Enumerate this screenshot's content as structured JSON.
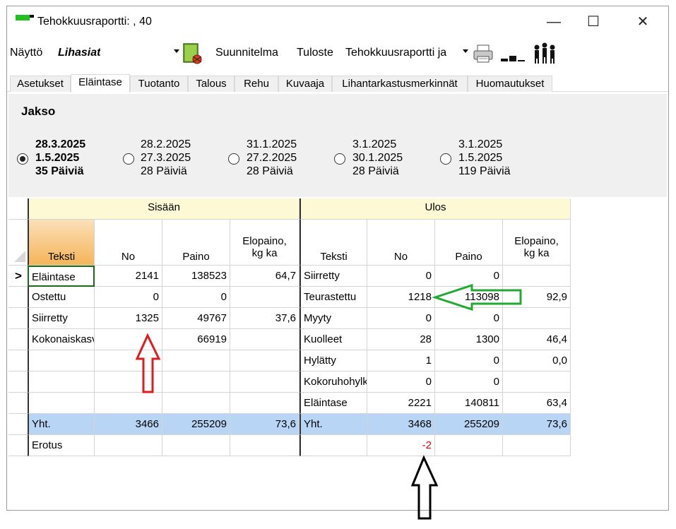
{
  "window": {
    "title": "Tehokkuusraportti: , 40",
    "minimize_label": "—",
    "maximize_label": "☐",
    "close_label": "✕"
  },
  "toolbar": {
    "nayttö_label": "Näyttö",
    "view_value": "Lihasiat",
    "suunnitelma_label": "Suunnitelma",
    "tuloste_label": "Tuloste",
    "report_value": "Tehokkuusraportti ja",
    "icons": [
      "book-bug-icon",
      "printer-icon",
      "bars-icon",
      "people-icon"
    ]
  },
  "tabs": [
    "Asetukset",
    "Eläintase",
    "Tuotanto",
    "Talous",
    "Rehu",
    "Kuvaaja",
    "Lihantarkastusmerkinnät",
    "Huomautukset"
  ],
  "active_tab": "Eläintase",
  "jakso": {
    "title": "Jakso",
    "periods": [
      {
        "start": "28.3.2025",
        "end": "1.5.2025",
        "days": "35 Päiviä",
        "selected": true
      },
      {
        "start": "28.2.2025",
        "end": "27.3.2025",
        "days": "28 Päiviä",
        "selected": false
      },
      {
        "start": "31.1.2025",
        "end": "27.2.2025",
        "days": "28 Päiviä",
        "selected": false
      },
      {
        "start": "3.1.2025",
        "end": "30.1.2025",
        "days": "28 Päiviä",
        "selected": false
      },
      {
        "start": "3.1.2025",
        "end": "1.5.2025",
        "days": "119 Päiviä",
        "selected": false
      }
    ]
  },
  "table": {
    "group_in": "Sisään",
    "group_out": "Ulos",
    "headers_in": [
      "Teksti",
      "No",
      "Paino",
      "Elopaino,\nkg ka"
    ],
    "headers_out": [
      "Teksti",
      "No",
      "Paino",
      "Elopaino,\nkg ka"
    ],
    "row_indicator": ">",
    "rows": [
      {
        "in": [
          "Eläintase",
          "2141",
          "138523",
          "64,7"
        ],
        "out": [
          "Siirretty",
          "0",
          "0",
          ""
        ]
      },
      {
        "in": [
          "Ostettu",
          "0",
          "0",
          ""
        ],
        "out": [
          "Teurastettu",
          "1218",
          "113098",
          "92,9"
        ]
      },
      {
        "in": [
          "Siirretty",
          "1325",
          "49767",
          "37,6"
        ],
        "out": [
          "Myyty",
          "0",
          "0",
          ""
        ]
      },
      {
        "in": [
          "Kokonaiskasvu",
          "",
          "66919",
          ""
        ],
        "out": [
          "Kuolleet",
          "28",
          "1300",
          "46,4"
        ]
      },
      {
        "in": [
          "",
          "",
          "",
          ""
        ],
        "out": [
          "Hylätty",
          "1",
          "0",
          "0,0"
        ]
      },
      {
        "in": [
          "",
          "",
          "",
          ""
        ],
        "out": [
          "Kokoruhohylkäys",
          "0",
          "0",
          ""
        ]
      },
      {
        "in": [
          "",
          "",
          "",
          ""
        ],
        "out": [
          "Eläintase",
          "2221",
          "140811",
          "63,4"
        ]
      }
    ],
    "total": {
      "in": [
        "Yht.",
        "3466",
        "255209",
        "73,6"
      ],
      "out": [
        "Yht.",
        "3468",
        "255209",
        "73,6"
      ]
    },
    "erotus": {
      "label": "Erotus",
      "value": "-2"
    }
  },
  "colors": {
    "group_header_bg": "#fcf9d4",
    "total_row_bg": "#b9d5f5",
    "difference_text": "#e00000",
    "arrow_red": "#dd1c1c",
    "arrow_green": "#22a833",
    "arrow_black": "#000000"
  }
}
